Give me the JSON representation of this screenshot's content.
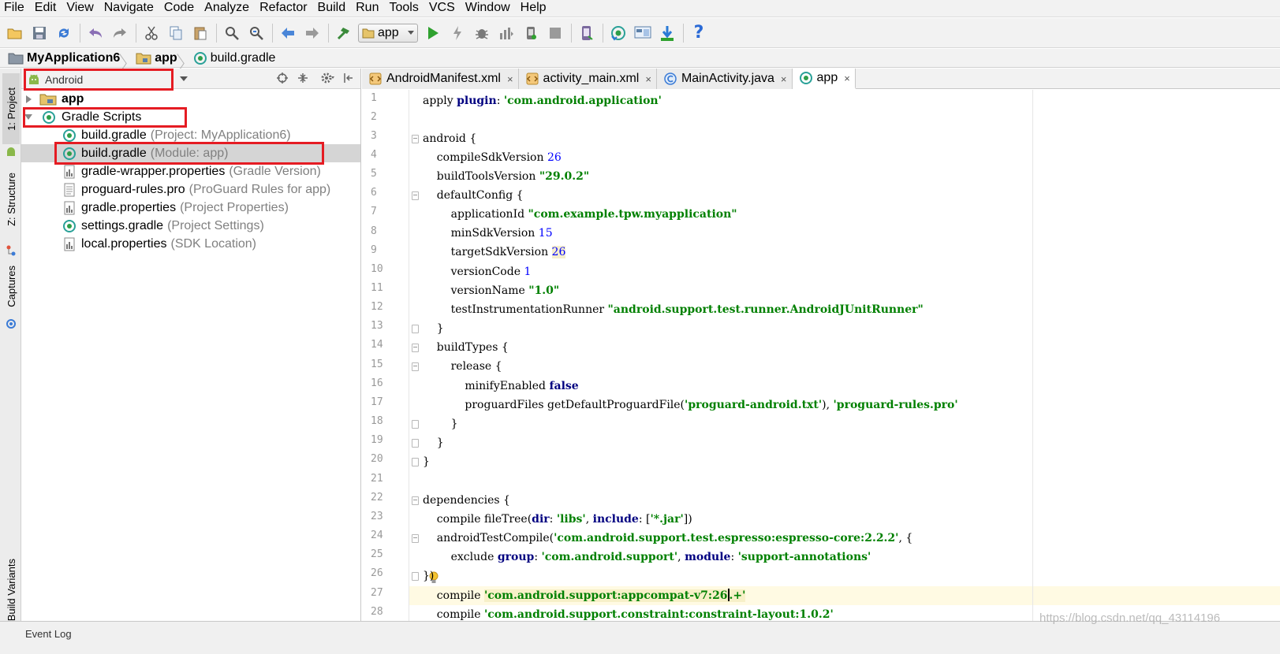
{
  "menu": [
    "File",
    "Edit",
    "View",
    "Navigate",
    "Code",
    "Analyze",
    "Refactor",
    "Build",
    "Run",
    "Tools",
    "VCS",
    "Window",
    "Help"
  ],
  "toolbar": {
    "run_config": "app",
    "icons": [
      "open-folder",
      "save",
      "sync",
      "undo",
      "redo",
      "cut",
      "copy",
      "paste",
      "find",
      "replace",
      "back",
      "forward",
      "make-project",
      "run",
      "apply-changes",
      "debug",
      "profile",
      "attach-debugger",
      "stop",
      "avd-manager",
      "sync-gradle",
      "project-structure",
      "sdk-manager",
      "help"
    ]
  },
  "breadcrumb": [
    "MyApplication6",
    "app",
    "build.gradle"
  ],
  "tool_stripe": {
    "project_tab": "1: Project",
    "structure_tab": "Z: Structure",
    "captures_tab": "Captures",
    "build_variants_tab": "Build Variants"
  },
  "project_panel": {
    "view_mode": "Android",
    "tree": [
      {
        "name": "app",
        "desc": "",
        "level": 0,
        "expanded": false,
        "bold": true
      },
      {
        "name": "Gradle Scripts",
        "desc": "",
        "level": 0,
        "expanded": true,
        "bold": false
      },
      {
        "name": "build.gradle",
        "desc": "(Project: MyApplication6)",
        "level": 1
      },
      {
        "name": "build.gradle",
        "desc": "(Module: app)",
        "level": 1,
        "selected": true
      },
      {
        "name": "gradle-wrapper.properties",
        "desc": "(Gradle Version)",
        "level": 1
      },
      {
        "name": "proguard-rules.pro",
        "desc": "(ProGuard Rules for app)",
        "level": 1
      },
      {
        "name": "gradle.properties",
        "desc": "(Project Properties)",
        "level": 1
      },
      {
        "name": "settings.gradle",
        "desc": "(Project Settings)",
        "level": 1
      },
      {
        "name": "local.properties",
        "desc": "(SDK Location)",
        "level": 1
      }
    ]
  },
  "editor": {
    "tabs": [
      {
        "label": "AndroidManifest.xml",
        "close": "×",
        "active": false
      },
      {
        "label": "activity_main.xml",
        "close": "×",
        "active": false
      },
      {
        "label": "MainActivity.java",
        "close": "×",
        "active": false
      },
      {
        "label": "app",
        "close": "×",
        "active": true
      }
    ],
    "line_numbers": [
      "1",
      "2",
      "3",
      "4",
      "5",
      "6",
      "7",
      "8",
      "9",
      "10",
      "11",
      "12",
      "13",
      "14",
      "15",
      "16",
      "17",
      "18",
      "19",
      "20",
      "21",
      "22",
      "23",
      "24",
      "25",
      "26",
      "27",
      "28"
    ],
    "lines": [
      "apply plugin: 'com.android.application'",
      "",
      "android {",
      "    compileSdkVersion 26",
      "    buildToolsVersion \"29.0.2\"",
      "    defaultConfig {",
      "        applicationId \"com.example.tpw.myapplication\"",
      "        minSdkVersion 15",
      "        targetSdkVersion 26",
      "        versionCode 1",
      "        versionName \"1.0\"",
      "        testInstrumentationRunner \"android.support.test.runner.AndroidJUnitRunner\"",
      "    }",
      "    buildTypes {",
      "        release {",
      "            minifyEnabled false",
      "            proguardFiles getDefaultProguardFile('proguard-android.txt'), 'proguard-rules.pro'",
      "        }",
      "    }",
      "}",
      "",
      "dependencies {",
      "    compile fileTree(dir: 'libs', include: ['*.jar'])",
      "    androidTestCompile('com.android.support.test.espresso:espresso-core:2.2.2', {",
      "        exclude group: 'com.android.support', module: 'support-annotations'",
      "    })",
      "    compile 'com.android.support:appcompat-v7:26.+'",
      "    compile 'com.android.support.constraint:constraint-layout:1.0.2'"
    ],
    "current_line": "27"
  },
  "bottom": {
    "event_log": "Event Log"
  },
  "watermark": "https://blog.csdn.net/qq_43114196",
  "colors": {
    "highlight_box": "#e51c23",
    "keyword": "#000080",
    "string": "#008000",
    "number": "#0000ff",
    "gradle_icon": "#2e9e4a"
  }
}
